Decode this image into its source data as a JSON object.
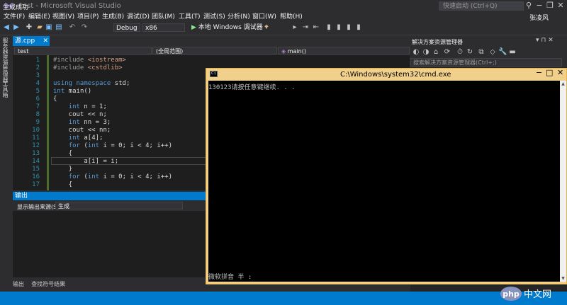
{
  "window": {
    "title": "test - Microsoft Visual Studio",
    "quick_launch_placeholder": "快速启动 (Ctrl+Q)",
    "user_name": "张凌风"
  },
  "menu": [
    "文件(F)",
    "编辑(E)",
    "视图(V)",
    "项目(P)",
    "生成(B)",
    "调试(D)",
    "团队(M)",
    "工具(T)",
    "测试(S)",
    "分析(N)",
    "窗口(W)",
    "帮助(H)"
  ],
  "toolbar": {
    "config": "Debug",
    "platform": "x86",
    "run_label": "本地 Windows 调试器"
  },
  "left_vertical_tabs": [
    "服务器资源管理器",
    "工具箱"
  ],
  "editor": {
    "tab": "源.cpp",
    "nav_project": "test",
    "nav_scope": "(全局范围)",
    "nav_member": "main()",
    "lines": [
      {
        "n": "1",
        "text": "#include <iostream>"
      },
      {
        "n": "2",
        "text": "#include <cstdlib>"
      },
      {
        "n": "3",
        "text": ""
      },
      {
        "n": "4",
        "text": "using namespace std;"
      },
      {
        "n": "5",
        "text": "int main()"
      },
      {
        "n": "6",
        "text": "{"
      },
      {
        "n": "7",
        "text": "    int n = 1;"
      },
      {
        "n": "8",
        "text": "    cout << n;"
      },
      {
        "n": "9",
        "text": "    int nn = 3;"
      },
      {
        "n": "10",
        "text": "    cout << nn;"
      },
      {
        "n": "11",
        "text": "    int a[4];"
      },
      {
        "n": "12",
        "text": "    for (int i = 0; i < 4; i++)"
      },
      {
        "n": "13",
        "text": "    {"
      },
      {
        "n": "14",
        "text": "        a[i] = i;"
      },
      {
        "n": "15",
        "text": "    }"
      },
      {
        "n": "16",
        "text": "    for (int i = 0; i < 4; i++)"
      },
      {
        "n": "17",
        "text": "    {"
      }
    ]
  },
  "output": {
    "header": "输出",
    "source_label": "显示输出来源(S):",
    "source_value": "生成",
    "bottom_tabs": [
      "输出",
      "查找符号结果"
    ]
  },
  "solution_explorer": {
    "title": "解决方案资源管理器",
    "search_placeholder": "搜索解决方案资源管理器(Ctrl+;)"
  },
  "cmd": {
    "title": "C:\\Windows\\system32\\cmd.exe",
    "output": "130123请按任意键继续. . .",
    "ime_text": "微软拼音 半 :"
  },
  "status": {
    "text": "生成成功"
  },
  "watermark": "php中文网"
}
